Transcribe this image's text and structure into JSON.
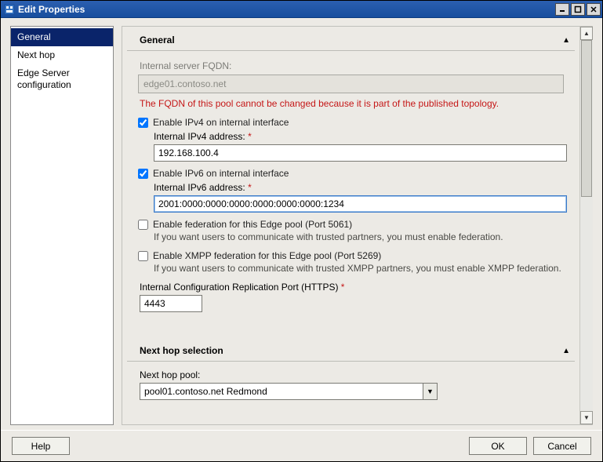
{
  "window": {
    "title": "Edit Properties"
  },
  "sidebar": {
    "items": [
      {
        "label": "General",
        "selected": true
      },
      {
        "label": "Next hop",
        "selected": false
      },
      {
        "label": "Edge Server configuration",
        "selected": false
      }
    ]
  },
  "sections": {
    "general": {
      "header": "General",
      "fqdn_label": "Internal server FQDN:",
      "fqdn_value": "edge01.contoso.net",
      "fqdn_error": "The FQDN of this pool cannot be changed because it is part of the published topology.",
      "ipv4": {
        "checkbox_label": "Enable IPv4 on internal interface",
        "checked": true,
        "address_label": "Internal IPv4 address:",
        "address_value": "192.168.100.4"
      },
      "ipv6": {
        "checkbox_label": "Enable IPv6 on internal interface",
        "checked": true,
        "address_label": "Internal IPv6 address:",
        "address_value": "2001:0000:0000:0000:0000:0000:0000:1234"
      },
      "federation": {
        "checkbox_label": "Enable federation for this Edge pool (Port 5061)",
        "checked": false,
        "hint": "If you want users to communicate with trusted partners, you must enable federation."
      },
      "xmpp": {
        "checkbox_label": "Enable XMPP federation for this Edge pool (Port 5269)",
        "checked": false,
        "hint": "If you want users to communicate with trusted XMPP partners, you must enable XMPP federation."
      },
      "repl_port": {
        "label": "Internal Configuration Replication Port (HTTPS)",
        "value": "4443"
      }
    },
    "nexthop": {
      "header": "Next hop selection",
      "pool_label": "Next hop pool:",
      "pool_value": "pool01.contoso.net   Redmond"
    }
  },
  "footer": {
    "help": "Help",
    "ok": "OK",
    "cancel": "Cancel"
  },
  "required_marker": "*"
}
